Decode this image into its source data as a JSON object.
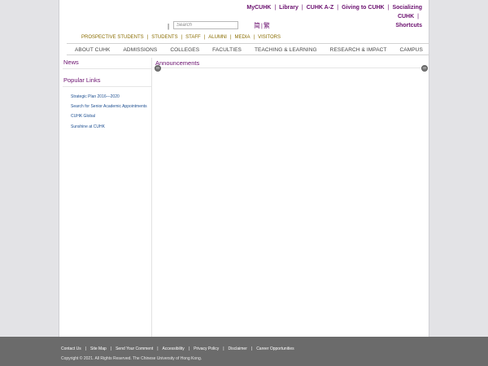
{
  "top_links": [
    "MyCUHK",
    "Library",
    "CUHK A-Z",
    "Giving to CUHK",
    "Socializing CUHK",
    "Shortcuts"
  ],
  "search": {
    "placeholder": "Search"
  },
  "language": {
    "simplified": "简",
    "traditional": "繁",
    "separator": "|"
  },
  "audience_links": [
    "PROSPECTIVE STUDENTS",
    "STUDENTS",
    "STAFF",
    "ALUMNI",
    "MEDIA",
    "VISITORS"
  ],
  "main_nav": [
    "ABOUT CUHK",
    "ADMISSIONS",
    "COLLEGES",
    "FACULTIES",
    "TEACHING & LEARNING",
    "RESEARCH & IMPACT",
    "CAMPUS"
  ],
  "sidebar": {
    "news_heading": "News",
    "popular_heading": "Popular Links",
    "popular_links": [
      "Strategic Plan 2016—2020",
      "Search for Senior Academic Appointments",
      "CUHK Global",
      "Sunshine at CUHK"
    ]
  },
  "main": {
    "announcements_heading": "Announcements",
    "collapse_symbol": "−"
  },
  "footer": {
    "links": [
      "Contact Us",
      "Site Map",
      "Send Your Comment",
      "Accessibility",
      "Privacy Policy",
      "Disclaimer",
      "Career Opportunities"
    ],
    "copyright": "Copyright © 2021. All Rights Reserved. The Chinese University of Hong Kong."
  },
  "colors": {
    "brand_purple": "#6a0f6e",
    "audience_gold": "#8a6d00",
    "link_blue": "#1d4f91",
    "footer_grey": "#6b6b6b"
  }
}
